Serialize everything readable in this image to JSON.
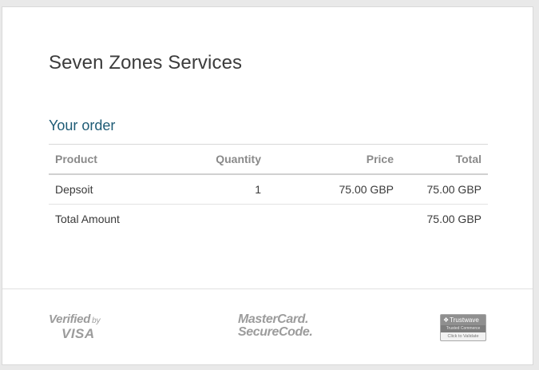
{
  "merchant": {
    "name": "Seven Zones Services"
  },
  "order": {
    "title": "Your order",
    "columns": {
      "product": "Product",
      "quantity": "Quantity",
      "price": "Price",
      "total": "Total"
    },
    "items": [
      {
        "product": "Depsoit",
        "quantity": "1",
        "price": "75.00 GBP",
        "total": "75.00 GBP"
      }
    ],
    "total_label": "Total Amount",
    "total_amount": "75.00 GBP"
  },
  "footer": {
    "visa": {
      "verified": "Verified",
      "by": "by",
      "brand": "VISA"
    },
    "mastercard": {
      "line1": "MasterCard.",
      "line2": "SecureCode."
    },
    "trustwave": {
      "name": "Trustwave",
      "subtitle": "Trusted Commerce",
      "action": "Click to Validate"
    }
  },
  "colors": {
    "heading_accent": "#1e5b75",
    "logo_gray": "#9c9c9c"
  }
}
